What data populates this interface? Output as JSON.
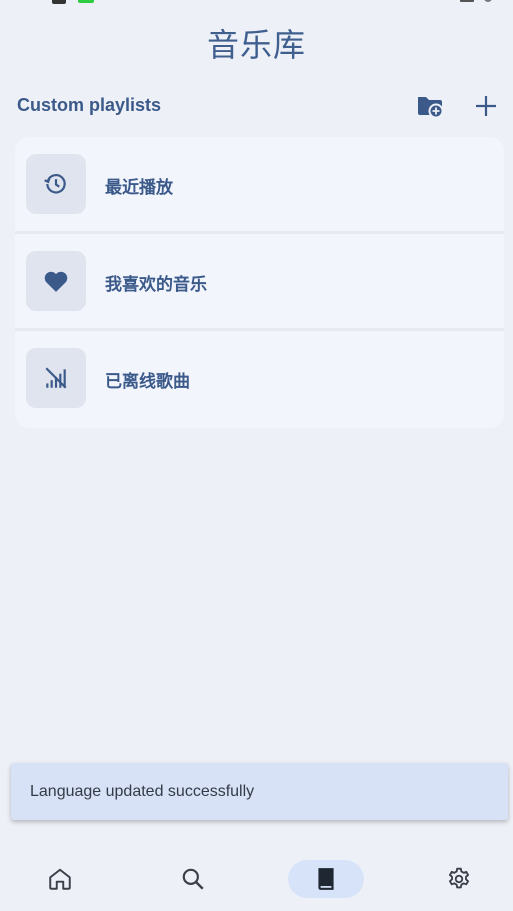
{
  "page_title": "音乐库",
  "section": {
    "title": "Custom playlists"
  },
  "header_actions": {
    "new_folder_icon": "folder-add-icon",
    "add_icon": "plus-icon"
  },
  "playlists": [
    {
      "label": "最近播放",
      "icon": "history-icon"
    },
    {
      "label": "我喜欢的音乐",
      "icon": "heart-icon"
    },
    {
      "label": "已离线歌曲",
      "icon": "offline-signal-icon"
    }
  ],
  "snackbar": {
    "message": "Language updated successfully"
  },
  "bottom_nav": {
    "items": [
      {
        "icon": "home-icon",
        "selected": false
      },
      {
        "icon": "search-icon",
        "selected": false
      },
      {
        "icon": "library-book-icon",
        "selected": true
      },
      {
        "icon": "settings-gear-icon",
        "selected": false
      }
    ]
  },
  "colors": {
    "accent": "#3B5A8A",
    "background": "#EEF0F7",
    "card": "#F3F5FD",
    "nav_selected": "#D6E3F8",
    "snackbar": "#D8E2F6"
  }
}
